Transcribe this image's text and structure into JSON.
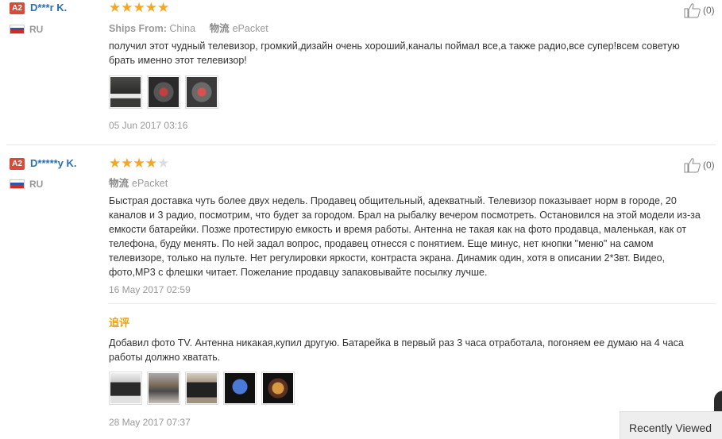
{
  "reviews": [
    {
      "badge": "A2",
      "username": "D***r K.",
      "country": "RU",
      "stars_filled": 5,
      "stars_total": 5,
      "ships_from_label": "Ships From:",
      "ships_from_value": "China",
      "shipping_label": "物流",
      "shipping_value": "ePacket",
      "text": "получил этот чудный телевизор, громкий,дизайн очень хороший,каналы поймал все,а также радио,все супер!всем советую брать именно этот телевизор!",
      "photo_count": 3,
      "date": "05 Jun 2017 03:16",
      "likes": "(0)"
    },
    {
      "badge": "A2",
      "username": "D*****y K.",
      "country": "RU",
      "stars_filled": 4,
      "stars_total": 5,
      "shipping_label": "物流",
      "shipping_value": "ePacket",
      "text": "Быстрая доставка чуть более двух недель. Продавец общительный, адекватный. Телевизор показывает норм в городе, 20 каналов и 3 радио, посмотрим, что будет за городом. Брал на рыбалку вечером посмотреть. Остановился на этой модели из-за емкости батарейки. Позже протестирую емкость и время работы. Антенна не такая как на фото продавца, маленькая, как от телефона, буду менять. По ней задал вопрос, продавец отнесся с понятием. Еще минус, нет кнопки \"меню\" на самом телевизоре, только на пульте. Нет регулировки яркости, контраста экрана. Динамик один, хотя в описании 2*3вт. Видео, фото,MP3 с флешки читает. Пожелание продавцу запаковывайте посылку лучше.",
      "date": "16 May 2017 02:59",
      "followup_label": "追评",
      "followup_text": "Добавил фото TV. Антенна никакая,купил другую. Батарейка в первый раз 3 часа отработала, погоняем ее думаю на 4 часа работы должно хватать.",
      "followup_photo_count": 5,
      "followup_date": "28 May 2017 07:37",
      "likes": "(0)"
    }
  ],
  "recently_viewed": {
    "label": "Recently Viewed"
  },
  "colors": {
    "star": "#f5a623",
    "username": "#2a6fb5",
    "badge": "#d84b3a",
    "followup": "#e8a317"
  },
  "icons": [
    "thumbs-up-icon",
    "star-icon",
    "russia-flag-icon"
  ]
}
